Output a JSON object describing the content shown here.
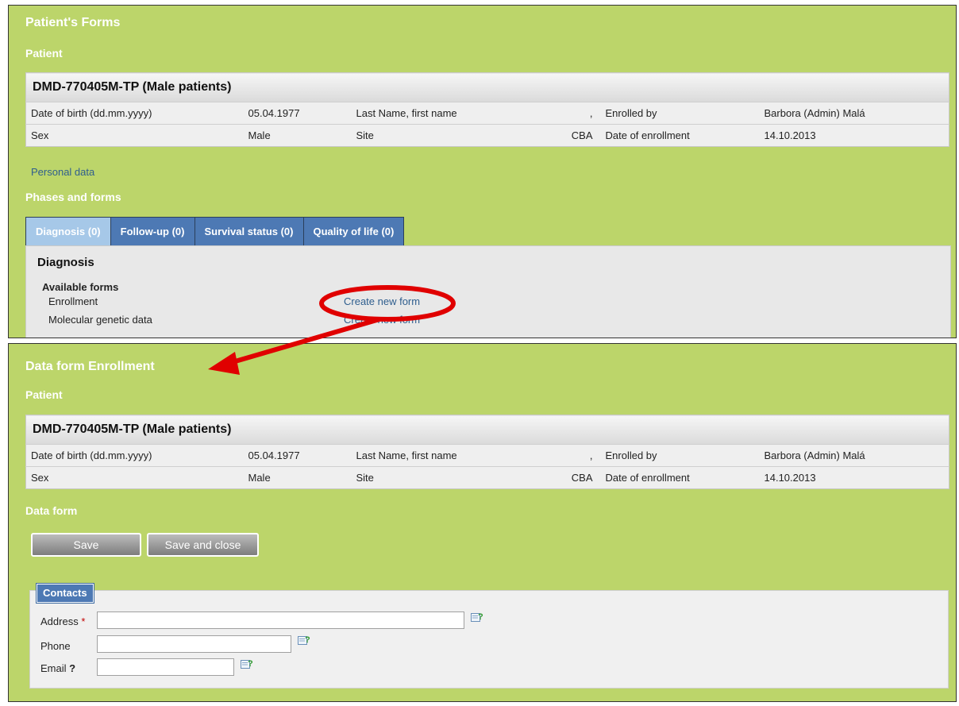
{
  "panel1": {
    "title": "Patient's Forms",
    "patient_section": "Patient",
    "personal_data_link": "Personal data",
    "phases_title": "Phases and forms",
    "tabs": [
      {
        "label": "Diagnosis (0)",
        "active": true
      },
      {
        "label": "Follow-up (0)",
        "active": false
      },
      {
        "label": "Survival status (0)",
        "active": false
      },
      {
        "label": "Quality of life (0)",
        "active": false
      }
    ],
    "diagnosis_heading": "Diagnosis",
    "available_forms_label": "Available forms",
    "forms": [
      {
        "name": "Enrollment",
        "action": "Create new form"
      },
      {
        "name": "Molecular genetic data",
        "action": "Create new form"
      }
    ]
  },
  "patient": {
    "header": "DMD-770405M-TP (Male patients)",
    "rows": [
      [
        "Date of birth (dd.mm.yyyy)",
        "05.04.1977",
        "Last Name, first name",
        ",",
        "Enrolled by",
        "Barbora (Admin) Malá"
      ],
      [
        "Sex",
        "Male",
        "Site",
        "CBA",
        "Date of enrollment",
        "14.10.2013"
      ]
    ]
  },
  "panel2": {
    "title": "Data form Enrollment",
    "patient_section": "Patient",
    "data_form_title": "Data form",
    "save_label": "Save",
    "save_close_label": "Save and close",
    "contacts_legend": "Contacts",
    "fields": {
      "address_label": "Address",
      "address_required": "*",
      "address_value": "",
      "phone_label": "Phone",
      "phone_value": "",
      "email_label": "Email",
      "email_help": "?",
      "email_value": ""
    }
  },
  "colors": {
    "panel_bg": "#bcd56a",
    "tab_bg": "#4d79b4",
    "tab_active_bg": "#a6c8e8",
    "link": "#2f5e8e",
    "annotation": "#e00000"
  }
}
